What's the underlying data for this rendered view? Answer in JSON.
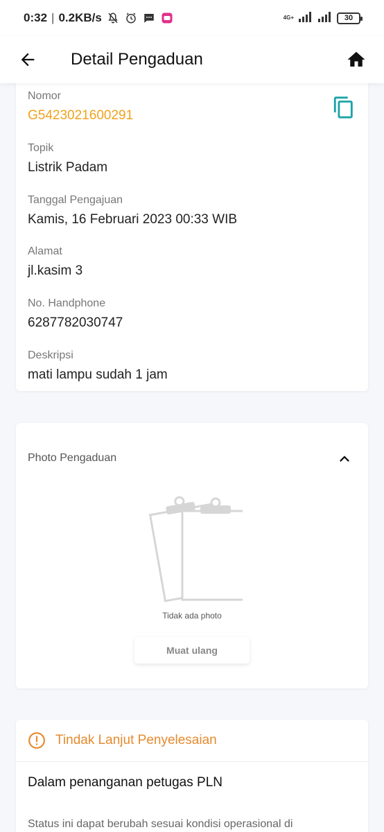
{
  "status_bar": {
    "time": "0:32",
    "speed": "0.2KB/s",
    "network": "4G+",
    "battery": "30",
    "icons": [
      "notifications-off-icon",
      "alarm-icon",
      "message-icon",
      "app-icon"
    ]
  },
  "app_bar": {
    "title": "Detail Pengaduan",
    "back_icon": "arrow-left-icon",
    "home_icon": "home-icon"
  },
  "detail": {
    "nomor_label": "Nomor",
    "nomor_value": "G5423021600291",
    "topik_label": "Topik",
    "topik_value": "Listrik Padam",
    "tanggal_label": "Tanggal Pengajuan",
    "tanggal_value": "Kamis, 16 Februari 2023 00:33 WIB",
    "alamat_label": "Alamat",
    "alamat_value": "jl.kasim 3",
    "hp_label": "No. Handphone",
    "hp_value": "6287782030747",
    "deskripsi_label": "Deskripsi",
    "deskripsi_value": "mati lampu sudah 1 jam",
    "copy_icon": "copy-icon"
  },
  "photo": {
    "title": "Photo Pengaduan",
    "empty_text": "Tidak ada photo",
    "reload_label": "Muat ulang"
  },
  "follow_up": {
    "title": "Tindak Lanjut Penyelesaian",
    "status": "Dalam penanganan petugas PLN",
    "note": "Status ini dapat berubah sesuai kondisi operasional di"
  },
  "colors": {
    "accent_orange": "#f0a21b",
    "alert_orange": "#e68a2e",
    "copy_teal": "#1aa3a8",
    "background": "#f6f7fb"
  }
}
